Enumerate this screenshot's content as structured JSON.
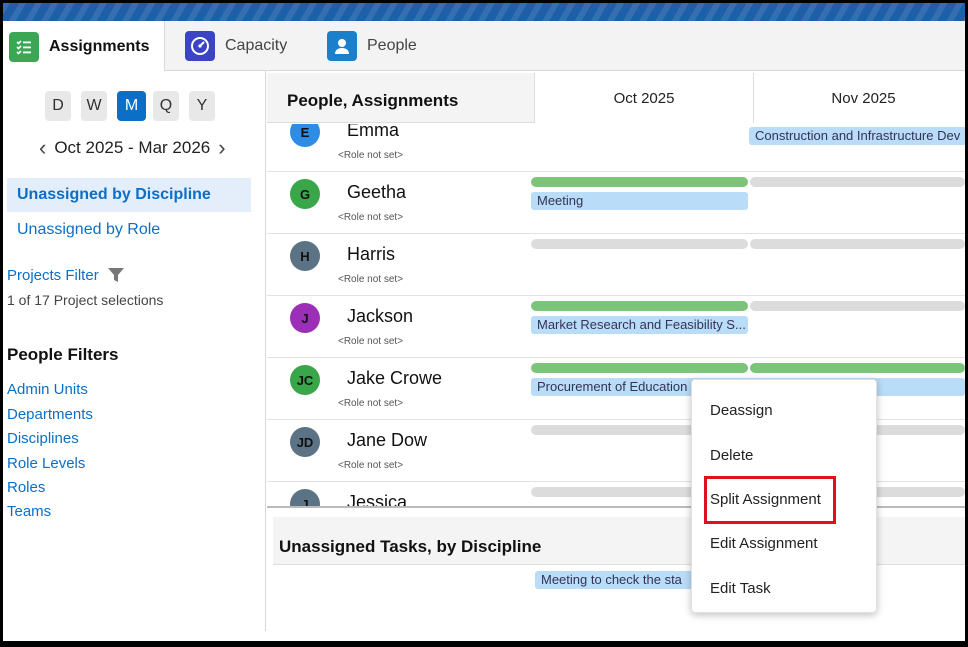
{
  "tabs": [
    {
      "label": "Assignments",
      "icon": "assignments-list-icon",
      "color": "#3ba755"
    },
    {
      "label": "Capacity",
      "icon": "gauge-icon",
      "color": "#3b45c4"
    },
    {
      "label": "People",
      "icon": "person-icon",
      "color": "#1b7fc9"
    }
  ],
  "sidebar": {
    "periods": [
      "D",
      "W",
      "M",
      "Q",
      "Y"
    ],
    "active_period": "M",
    "range_label": "Oct 2025 - Mar 2026",
    "nav_items": [
      {
        "label": "Unassigned by Discipline",
        "active": true
      },
      {
        "label": "Unassigned by Role",
        "active": false
      }
    ],
    "projects_filter_label": "Projects Filter",
    "project_selection_text": "1 of 17 Project selections",
    "people_filters_title": "People Filters",
    "people_filters": [
      "Admin Units",
      "Departments",
      "Disciplines",
      "Role Levels",
      "Roles",
      "Teams"
    ]
  },
  "grid": {
    "header_title": "People, Assignments",
    "months": [
      "Oct 2025",
      "Nov 2025"
    ],
    "people": [
      {
        "initials": "E",
        "name": "Emma",
        "role": "<Role not set>",
        "avatar_color": "#2f8ce6",
        "tasks": [
          {
            "label": "Construction and Infrastructure Dev",
            "month": 1
          }
        ]
      },
      {
        "initials": "G",
        "name": "Geetha",
        "role": "<Role not set>",
        "avatar_color": "#3aa64a",
        "bars": [
          "green",
          "gray"
        ],
        "tasks": [
          {
            "label": "Meeting",
            "month": 0
          }
        ]
      },
      {
        "initials": "H",
        "name": "Harris",
        "role": "<Role not set>",
        "avatar_color": "#5c7385",
        "bars": [
          "gray",
          "gray"
        ],
        "tasks": []
      },
      {
        "initials": "J",
        "name": "Jackson",
        "role": "<Role not set>",
        "avatar_color": "#9c2fb8",
        "bars": [
          "green",
          "gray"
        ],
        "tasks": [
          {
            "label": "Market Research and Feasibility S...",
            "month": 0
          }
        ]
      },
      {
        "initials": "JC",
        "name": "Jake Crowe",
        "role": "<Role not set>",
        "avatar_color": "#3aa64a",
        "bars": [
          "green",
          "green"
        ],
        "tasks": [
          {
            "label": "Procurement of Education",
            "month": 0
          }
        ]
      },
      {
        "initials": "JD",
        "name": "Jane Dow",
        "role": "<Role not set>",
        "avatar_color": "#5c7385",
        "bars": [
          "gray",
          "gray"
        ],
        "tasks": []
      },
      {
        "initials": "J",
        "name": "Jessica",
        "role": "",
        "avatar_color": "#5c7385",
        "bars": [
          "gray",
          "gray"
        ],
        "tasks": []
      }
    ]
  },
  "unassigned": {
    "title": "Unassigned Tasks, by Discipline",
    "task_label": "Meeting to check the sta"
  },
  "context_menu": {
    "items": [
      "Deassign",
      "Delete",
      "Split Assignment",
      "Edit Assignment",
      "Edit Task"
    ],
    "highlighted": "Split Assignment"
  }
}
